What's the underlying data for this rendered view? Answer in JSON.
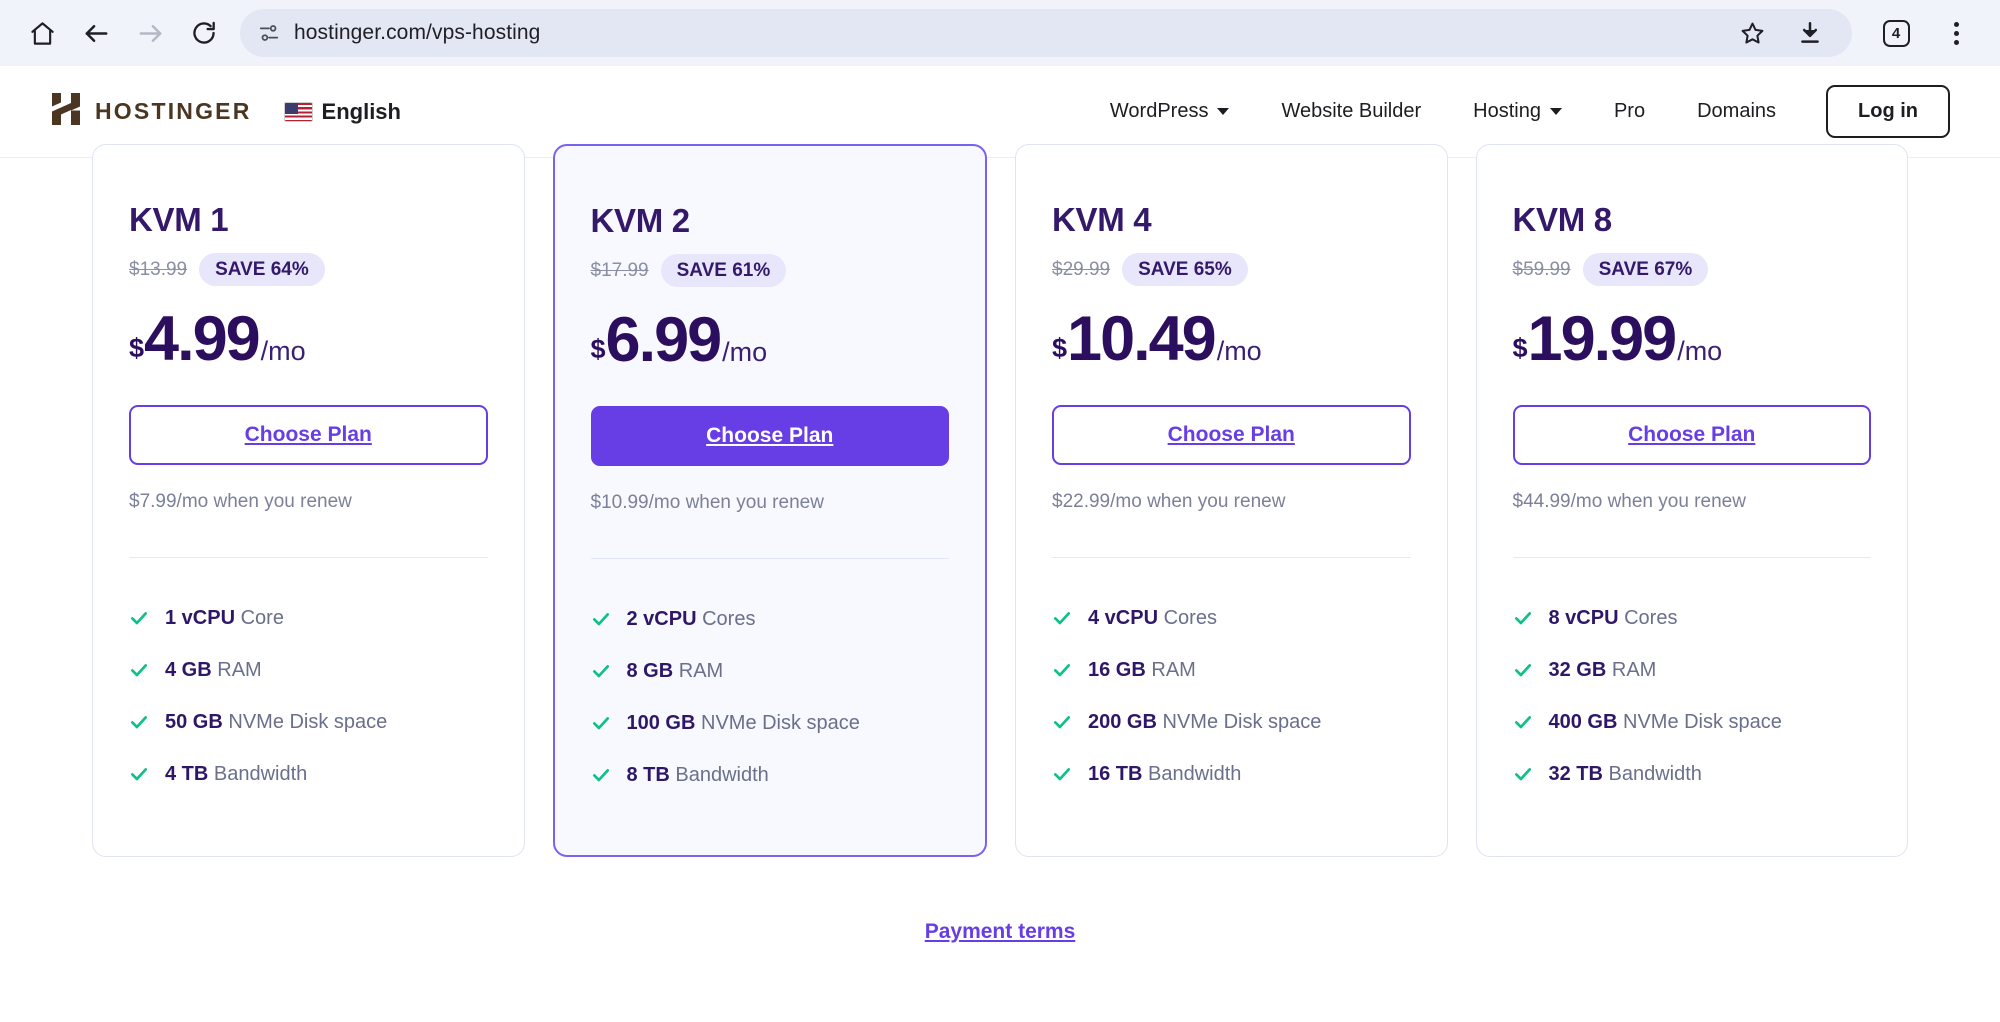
{
  "browser": {
    "url": "hostinger.com/vps-hosting",
    "tab_count": "4",
    "icons": {
      "home": "home-icon",
      "back": "back-arrow-icon",
      "forward": "forward-arrow-icon",
      "reload": "reload-icon",
      "site_info": "site-settings-icon",
      "bookmark": "bookmark-star-icon",
      "download": "download-icon",
      "tabs": "tab-count-icon",
      "menu": "kebab-menu-icon"
    }
  },
  "header": {
    "brand": "HOSTINGER",
    "language": "English",
    "nav": [
      {
        "label": "WordPress",
        "has_caret": true
      },
      {
        "label": "Website Builder",
        "has_caret": false
      },
      {
        "label": "Hosting",
        "has_caret": true
      },
      {
        "label": "Pro",
        "has_caret": false
      },
      {
        "label": "Domains",
        "has_caret": false
      }
    ],
    "login_label": "Log in"
  },
  "colors": {
    "accent": "#673de6",
    "accent_border": "#7b61f0",
    "heading": "#34196b",
    "price": "#2c0e5e",
    "badge_bg": "#e7e6fb",
    "check": "#0ec08a",
    "logo": "#4b3621",
    "muted": "#7c8098"
  },
  "plans": [
    {
      "name": "KVM 1",
      "old_price": "$13.99",
      "save": "SAVE 64%",
      "currency": "$",
      "amount": "4.99",
      "period": "/mo",
      "cta": "Choose Plan",
      "featured": false,
      "renew": "$7.99/mo when you renew",
      "features": [
        {
          "value": "1 vCPU",
          "label": "Core"
        },
        {
          "value": "4 GB",
          "label": "RAM"
        },
        {
          "value": "50 GB",
          "label": "NVMe Disk space"
        },
        {
          "value": "4 TB",
          "label": "Bandwidth"
        }
      ]
    },
    {
      "name": "KVM 2",
      "old_price": "$17.99",
      "save": "SAVE 61%",
      "currency": "$",
      "amount": "6.99",
      "period": "/mo",
      "cta": "Choose Plan",
      "featured": true,
      "renew": "$10.99/mo when you renew",
      "features": [
        {
          "value": "2 vCPU",
          "label": "Cores"
        },
        {
          "value": "8 GB",
          "label": "RAM"
        },
        {
          "value": "100 GB",
          "label": "NVMe Disk space"
        },
        {
          "value": "8 TB",
          "label": "Bandwidth"
        }
      ]
    },
    {
      "name": "KVM 4",
      "old_price": "$29.99",
      "save": "SAVE 65%",
      "currency": "$",
      "amount": "10.49",
      "period": "/mo",
      "cta": "Choose Plan",
      "featured": false,
      "renew": "$22.99/mo when you renew",
      "features": [
        {
          "value": "4 vCPU",
          "label": "Cores"
        },
        {
          "value": "16 GB",
          "label": "RAM"
        },
        {
          "value": "200 GB",
          "label": "NVMe Disk space"
        },
        {
          "value": "16 TB",
          "label": "Bandwidth"
        }
      ]
    },
    {
      "name": "KVM 8",
      "old_price": "$59.99",
      "save": "SAVE 67%",
      "currency": "$",
      "amount": "19.99",
      "period": "/mo",
      "cta": "Choose Plan",
      "featured": false,
      "renew": "$44.99/mo when you renew",
      "features": [
        {
          "value": "8 vCPU",
          "label": "Cores"
        },
        {
          "value": "32 GB",
          "label": "RAM"
        },
        {
          "value": "400 GB",
          "label": "NVMe Disk space"
        },
        {
          "value": "32 TB",
          "label": "Bandwidth"
        }
      ]
    }
  ],
  "footer": {
    "payment_terms": "Payment terms"
  }
}
